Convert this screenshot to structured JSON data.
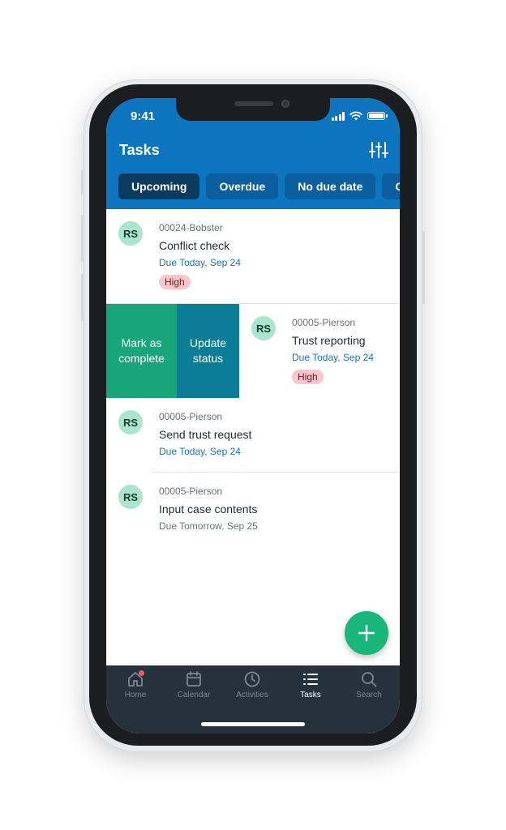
{
  "status": {
    "time": "9:41"
  },
  "header": {
    "title": "Tasks",
    "filter_icon": "sliders-icon"
  },
  "tabs": [
    {
      "label": "Upcoming",
      "active": true
    },
    {
      "label": "Overdue",
      "active": false
    },
    {
      "label": "No due date",
      "active": false
    },
    {
      "label": "C",
      "active": false
    }
  ],
  "tasks": [
    {
      "avatar": "RS",
      "case": "00024-Bobster",
      "title": "Conflict check",
      "due": "Due Today, Sep 24",
      "priority": "High"
    },
    {
      "avatar": "RS",
      "case": "00005-Pierson",
      "title": "Trust reporting",
      "due": "Due Today, Sep 24",
      "priority": "High"
    },
    {
      "avatar": "RS",
      "case": "00005-Pierson",
      "title": "Send trust request",
      "due": "Due Today, Sep 24"
    },
    {
      "avatar": "RS",
      "case": "00005-Pierson",
      "title": "Input case contents",
      "due": "Due Tomorrow, Sep 25"
    }
  ],
  "swipe_actions": {
    "mark_complete": "Mark as complete",
    "update_status": "Update status"
  },
  "bottom_nav": [
    {
      "label": "Home",
      "icon": "home-icon",
      "has_notification": true
    },
    {
      "label": "Calendar",
      "icon": "calendar-icon"
    },
    {
      "label": "Activities",
      "icon": "clock-icon"
    },
    {
      "label": "Tasks",
      "icon": "list-icon",
      "active": true
    },
    {
      "label": "Search",
      "icon": "search-icon"
    }
  ],
  "colors": {
    "header_blue": "#0d74bf",
    "active_tab": "#0a3a5e",
    "complete_green": "#18a577",
    "update_teal": "#0c7d96",
    "fab_green": "#19b67c",
    "bottom_bar": "#25313b"
  }
}
